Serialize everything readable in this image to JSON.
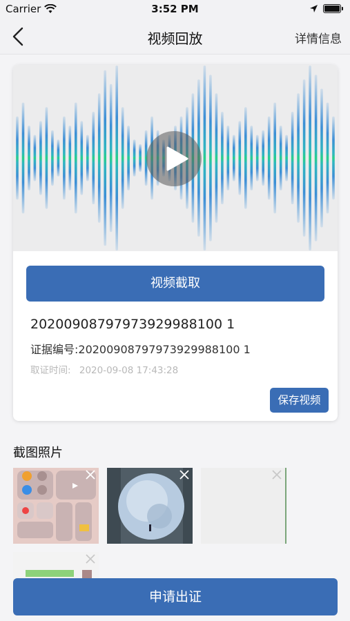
{
  "status_bar": {
    "carrier": "Carrier",
    "time": "3:52 PM"
  },
  "nav": {
    "title": "视频回放",
    "right_label": "详情信息"
  },
  "video": {
    "capture_label": "视频截取",
    "evidence_id": "20200908797973929988100 1",
    "evidence_number_label": "证据编号:20200908797973929988100 1",
    "evidence_time_label": "取证时间:",
    "evidence_time": "2020-09-08 17:43:28",
    "save_label": "保存视频"
  },
  "screenshots": {
    "title": "截图照片"
  },
  "footer": {
    "apply_label": "申请出证"
  },
  "colors": {
    "primary": "#3a6db5",
    "wave_blue": "#3d8fd6",
    "wave_green": "#27d08a"
  },
  "icons": [
    "wifi-icon",
    "location-arrow-icon",
    "battery-icon",
    "back-chevron-icon",
    "play-icon",
    "close-icon"
  ]
}
